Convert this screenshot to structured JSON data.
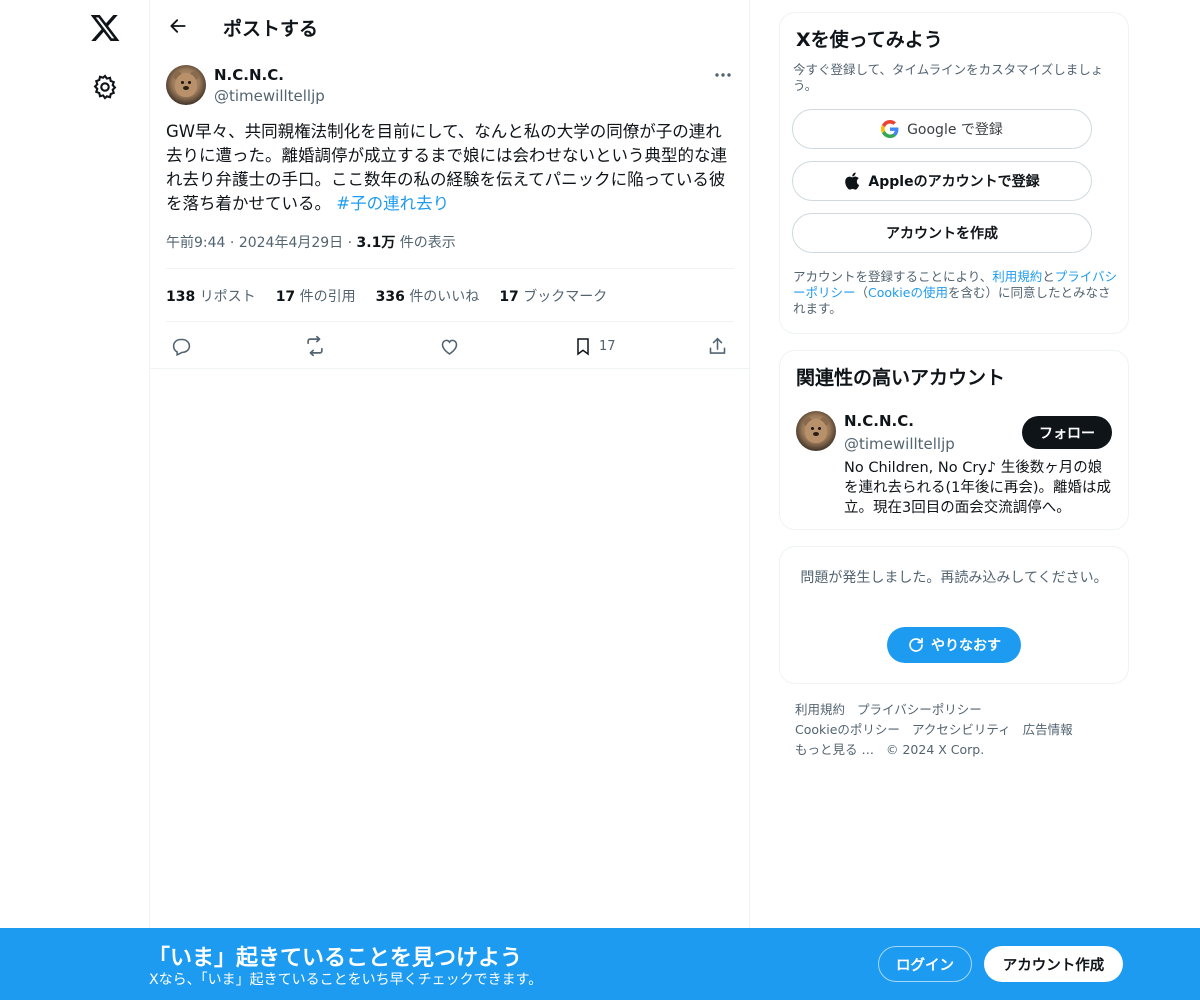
{
  "nav": {
    "logo_icon": "x-logo-icon",
    "settings_icon": "gear-icon"
  },
  "header": {
    "title": "ポストする",
    "back_icon": "arrow-left-icon"
  },
  "post": {
    "author_name": "N.C.N.C.",
    "author_handle": "@timewilltelljp",
    "text": "GW早々、共同親権法制化を目前にして、なんと私の大学の同僚が子の連れ去りに遭った。離婚調停が成立するまで娘には会わせないという典型的な連れ去り弁護士の手口。ここ数年の私の経験を伝えてパニックに陥っている彼を落ち着かせている。",
    "hashtag": "#子の連れ去り",
    "time": "午前9:44",
    "date": "2024年4月29日",
    "views_count": "3.1万",
    "views_label": "件の表示",
    "stats": {
      "reposts_count": "138",
      "reposts_label": "リポスト",
      "quotes_count": "17",
      "quotes_label": "件の引用",
      "likes_count": "336",
      "likes_label": "件のいいね",
      "bookmarks_count": "17",
      "bookmarks_label": "ブックマーク"
    },
    "actions": {
      "bookmark_count": "17"
    }
  },
  "signup_card": {
    "title": "Xを使ってみよう",
    "subtitle": "今すぐ登録して、タイムラインをカスタマイズしましょう。",
    "google_label": "Google で登録",
    "apple_label": "Appleのアカウントで登録",
    "create_label": "アカウントを作成",
    "legal_prefix": "アカウントを登録することにより、",
    "legal_terms": "利用規約",
    "legal_and": "と",
    "legal_privacy": "プライバシーポリシー",
    "legal_paren_open": "（",
    "legal_cookie": "Cookieの使用",
    "legal_suffix": "を含む）に同意したとみなされます。"
  },
  "related_card": {
    "title": "関連性の高いアカウント",
    "name": "N.C.N.C.",
    "handle": "@timewilltelljp",
    "follow_label": "フォロー",
    "bio": "No Children, No Cry♪ 生後数ヶ月の娘を連れ去られる(1年後に再会)。離婚は成立。現在3回目の面会交流調停へ。"
  },
  "error_card": {
    "message": "問題が発生しました。再読み込みしてください。",
    "retry_label": "やりなおす"
  },
  "footer": {
    "terms": "利用規約",
    "privacy": "プライバシーポリシー",
    "cookie": "Cookieのポリシー",
    "accessibility": "アクセシビリティ",
    "ads": "広告情報",
    "more": "もっと見る …",
    "copyright": "© 2024 X Corp."
  },
  "bottom_bar": {
    "title": "「いま」起きていることを見つけよう",
    "subtitle": "Xなら、「いま」起きていることをいち早くチェックできます。",
    "login_label": "ログイン",
    "signup_label": "アカウント作成"
  },
  "colors": {
    "accent": "#1d9bf0",
    "text": "#0f1419",
    "secondary": "#536471"
  }
}
